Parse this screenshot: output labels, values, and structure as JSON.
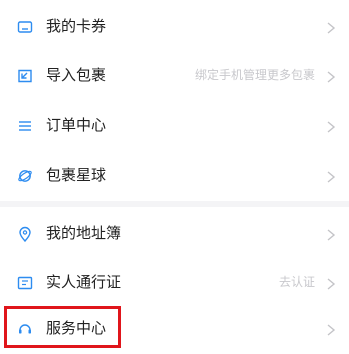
{
  "accent_color": "#2d8cf0",
  "highlight_color": "#e0151b",
  "group_1": {
    "items": [
      {
        "label": "我的卡券",
        "icon": "coupon-card-icon"
      },
      {
        "label": "导入包裹",
        "hint": "绑定手机管理更多包裹",
        "icon": "import-package-icon"
      },
      {
        "label": "订单中心",
        "icon": "list-lines-icon"
      },
      {
        "label": "包裹星球",
        "icon": "planet-icon"
      }
    ]
  },
  "group_2": {
    "items": [
      {
        "label": "我的地址簿",
        "icon": "location-pin-icon"
      },
      {
        "label": "实人通行证",
        "hint": "去认证",
        "icon": "id-card-icon"
      },
      {
        "label": "服务中心",
        "icon": "headset-icon"
      }
    ]
  },
  "chevron_icon": "chevron-right-icon"
}
